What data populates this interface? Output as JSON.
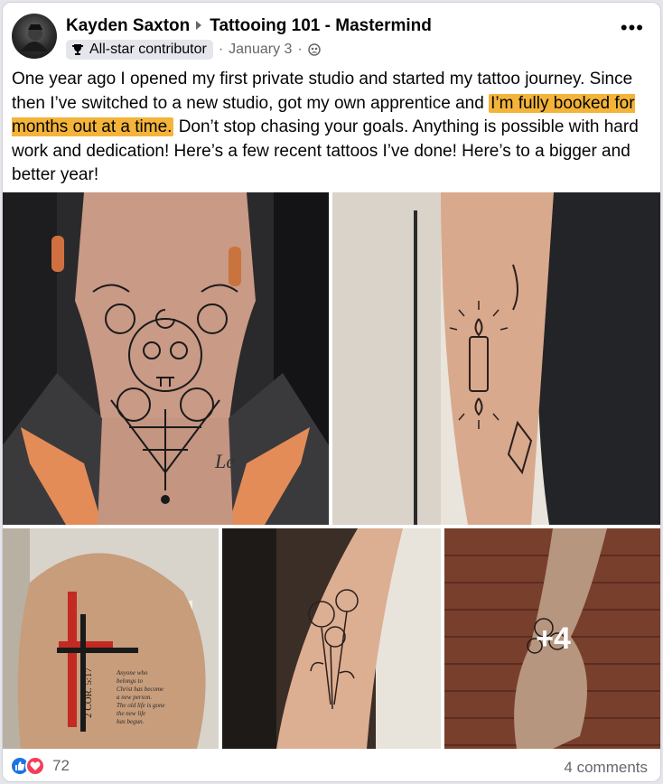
{
  "post": {
    "author": "Kayden Saxton",
    "group": "Tattooing 101 - Mastermind",
    "badge": "All-star contributor",
    "date": "January 3",
    "more_label": "•••",
    "text_part1": "One year ago I opened my first private studio and started my tattoo journey. Since then I’ve switched to a new studio, got my own apprentice and ",
    "text_highlight": "I’m fully booked for months out at a time.",
    "text_part2": " Don’t stop chasing your goals. Anything is possible with hard work and dedication! Here’s a few recent tattoos I’ve done! Here’s to a bigger and better year!",
    "highlight_color": "#f4b43a"
  },
  "photos": {
    "items": [
      {
        "subject": "neck tattoo - skull, roses, moon and spiderweb"
      },
      {
        "subject": "forearm tattoo - candle with sunbursts"
      },
      {
        "subject": "shoulder tattoo - red cross with nails and scripture",
        "scripture_ref": "2 COR. 5:17",
        "verse": "Anyone who belongs to Christ has become a new person. The old life is gone, the new life has begun."
      },
      {
        "subject": "forearm tattoo - flower bouquet"
      },
      {
        "subject": "hand tattoo - flowers"
      }
    ],
    "extra_count": "+4"
  },
  "footer": {
    "reaction_count": "72",
    "comments": "4 comments",
    "like_color": "#1b74e4",
    "love_color": "#f33e58"
  }
}
